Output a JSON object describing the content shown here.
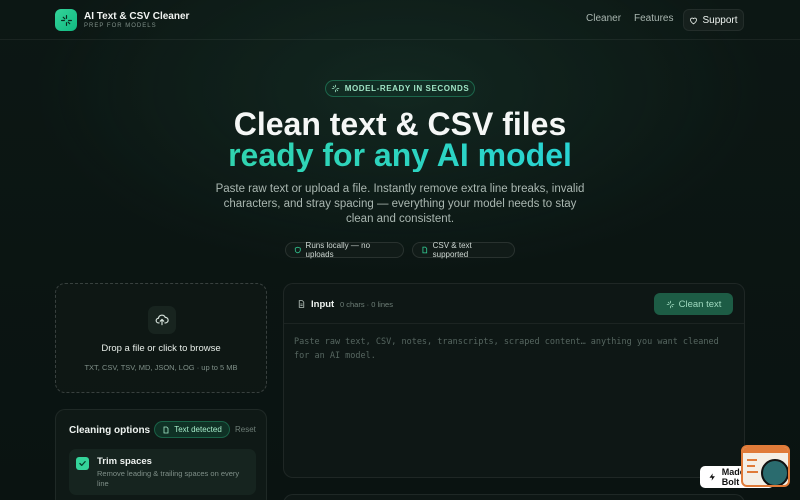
{
  "app": {
    "name": "AI Text & CSV Cleaner",
    "tagline": "PREP FOR MODELS"
  },
  "nav": {
    "items": [
      "Cleaner",
      "Features"
    ],
    "support_label": "Support"
  },
  "hero": {
    "badge": "MODEL-READY IN SECONDS",
    "title_line1": "Clean text & CSV files",
    "title_line2": "ready for any AI model",
    "description": "Paste raw text or upload a file. Instantly remove extra line breaks, invalid characters, and stray spacing — everything your model needs to stay clean and consistent.",
    "pills": [
      "Runs locally — no uploads",
      "CSV & text supported"
    ]
  },
  "dropzone": {
    "title": "Drop a file or click to browse",
    "subtitle": "TXT, CSV, TSV, MD, JSON, LOG · up to 5 MB"
  },
  "options": {
    "title": "Cleaning options",
    "detected_badge": "Text detected",
    "reset_label": "Reset",
    "items": [
      {
        "name": "Trim spaces",
        "description": "Remove leading & trailing spaces on every line",
        "checked": true
      }
    ]
  },
  "input": {
    "title": "Input",
    "meta": "0 chars · 0 lines",
    "clean_button": "Clean text",
    "placeholder": "Paste raw text, CSV, notes, transcripts, scraped content… anything you want cleaned for an AI model.",
    "value": ""
  },
  "made_in": {
    "label": "Made in Bolt"
  },
  "colors": {
    "accent": "#34d399",
    "accent_teal": "#2dd4bf",
    "background": "#0b1412",
    "button_bg": "#1d5c45"
  },
  "icons": [
    "sparkle-icon",
    "heart-icon",
    "shield-icon",
    "file-icon",
    "upload-cloud-icon",
    "check-icon",
    "document-icon",
    "bolt-icon"
  ]
}
